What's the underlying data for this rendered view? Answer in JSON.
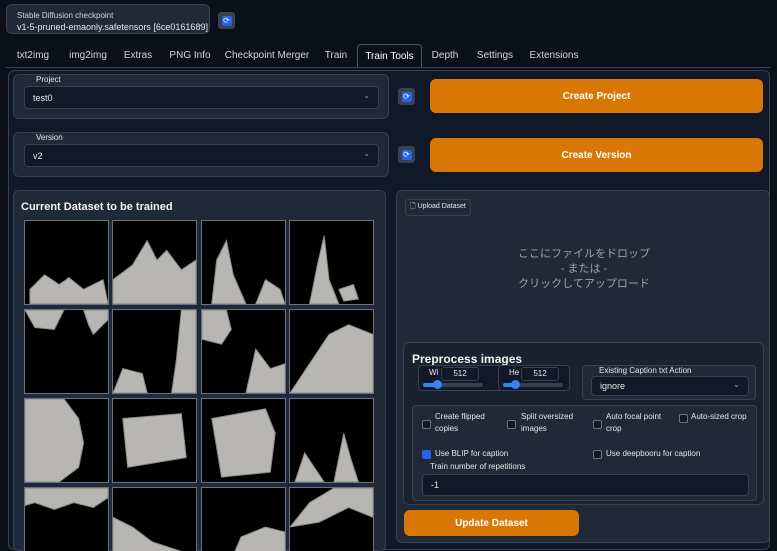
{
  "checkpoint": {
    "label": "Stable Diffusion checkpoint",
    "value": "v1-5-pruned-emaonly.safetensors [6ce0161689]",
    "refresh_icon": "refresh-icon"
  },
  "tabs": [
    "txt2img",
    "img2img",
    "Extras",
    "PNG Info",
    "Checkpoint Merger",
    "Train",
    "Train Tools",
    "Depth",
    "Settings",
    "Extensions"
  ],
  "active_tab": "Train Tools",
  "project": {
    "label": "Project",
    "value": "test0",
    "button": "Create Project"
  },
  "version": {
    "label": "Version",
    "value": "v2",
    "button": "Create Version"
  },
  "gallery": {
    "title": "Current Dataset to be trained"
  },
  "upload": {
    "tag": "Upload Dataset",
    "line1": "ここにファイルをドロップ",
    "line2": "- または -",
    "line3": "クリックしてアップロード"
  },
  "preprocess": {
    "title": "Preprocess images",
    "width_label": "Wi",
    "width_value": "512",
    "height_label": "He",
    "height_value": "512",
    "caption_action_label": "Existing Caption txt Action",
    "caption_action_value": "ignore",
    "checkboxes": [
      {
        "label": "Create flipped copies",
        "checked": false
      },
      {
        "label": "Split oversized images",
        "checked": false
      },
      {
        "label": "Auto focal point crop",
        "checked": false
      },
      {
        "label": "Auto-sized crop",
        "checked": false
      },
      {
        "label": "Use BLIP for caption",
        "checked": true
      },
      {
        "label": "Use deepbooru for caption",
        "checked": false
      }
    ],
    "repetitions_label": "Train number of repetitions",
    "repetitions_value": "-1"
  },
  "update_button": "Update Dataset",
  "colors": {
    "accent": "#d97706",
    "background": "#0b0f19",
    "checkbox": "#2563eb"
  }
}
